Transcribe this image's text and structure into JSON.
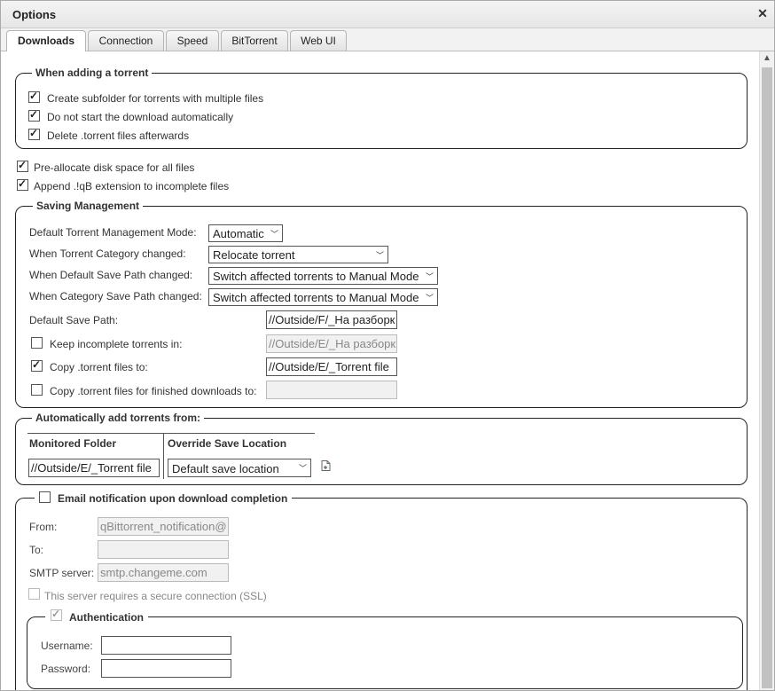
{
  "window": {
    "title": "Options"
  },
  "tabs": [
    "Downloads",
    "Connection",
    "Speed",
    "BitTorrent",
    "Web UI"
  ],
  "adding": {
    "legend": "When adding a torrent",
    "subfolder": "Create subfolder for torrents with multiple files",
    "no_start": "Do not start the download automatically",
    "delete_torrent": "Delete .torrent files afterwards"
  },
  "preallocate": "Pre-allocate disk space for all files",
  "append_ext": "Append .!qB extension to incomplete files",
  "saving": {
    "legend": "Saving Management",
    "mode_label": "Default Torrent Management Mode:",
    "mode_value": "Automatic",
    "cat_changed_label": "When Torrent Category changed:",
    "cat_changed_value": "Relocate torrent",
    "default_path_changed_label": "When Default Save Path changed:",
    "default_path_changed_value": "Switch affected torrents to Manual Mode",
    "cat_path_changed_label": "When Category Save Path changed:",
    "cat_path_changed_value": "Switch affected torrents to Manual Mode",
    "save_path_label": "Default Save Path:",
    "save_path_value": "//Outside/F/_На разборк",
    "keep_incomplete_label": "Keep incomplete torrents in:",
    "keep_incomplete_value": "//Outside/E/_На разборк",
    "copy_torrent_label": "Copy .torrent files to:",
    "copy_torrent_value": "//Outside/E/_Torrent file",
    "copy_finished_label": "Copy .torrent files for finished downloads to:",
    "copy_finished_value": ""
  },
  "auto_add": {
    "legend": "Automatically add torrents from:",
    "col_folder": "Monitored Folder",
    "col_override": "Override Save Location",
    "folder_value": "//Outside/E/_Torrent file",
    "override_value": "Default save location"
  },
  "email": {
    "legend": "Email notification upon download completion",
    "from_label": "From:",
    "from_value": "qBittorrent_notification@",
    "to_label": "To:",
    "to_value": "",
    "smtp_label": "SMTP server:",
    "smtp_value": "smtp.changeme.com",
    "ssl_label": "This server requires a secure connection (SSL)",
    "auth_legend": "Authentication",
    "username_label": "Username:",
    "username_value": "",
    "password_label": "Password:",
    "password_value": ""
  }
}
